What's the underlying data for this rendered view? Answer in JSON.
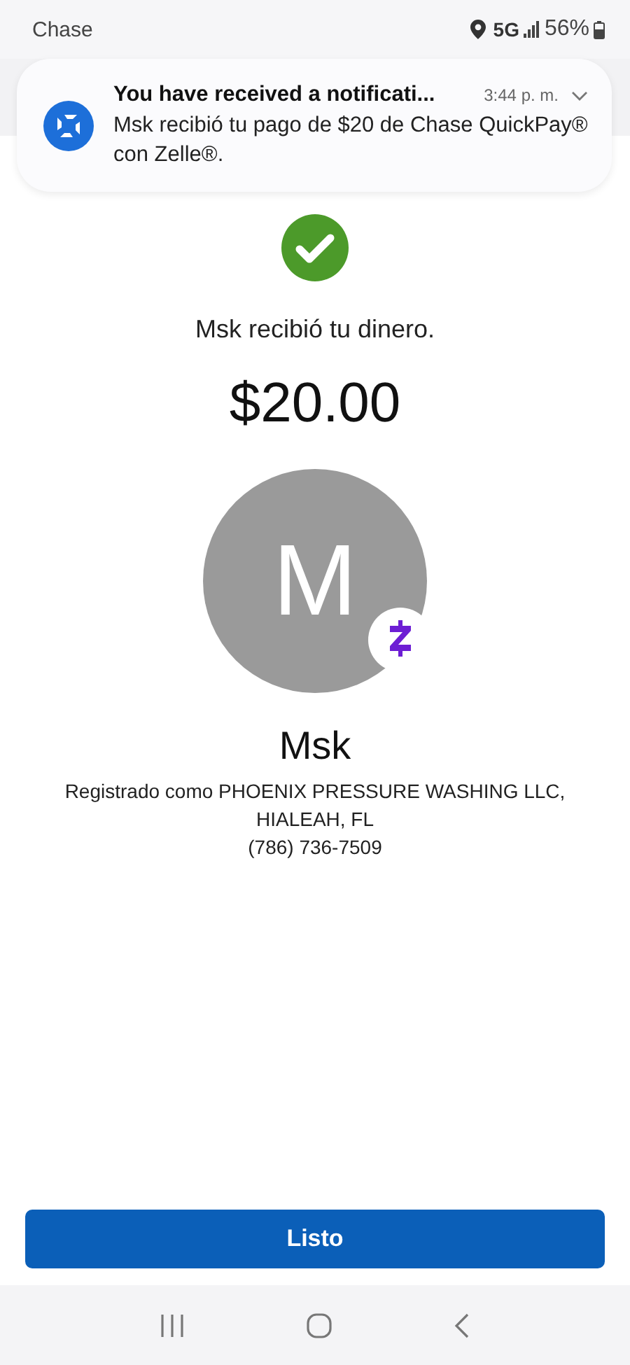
{
  "status_bar": {
    "app": "Chase",
    "network": "5G",
    "battery": "56%"
  },
  "notification": {
    "title": "You have received a notificati...",
    "time": "3:44 p. m.",
    "message": "Msk recibió tu pago de $20 de Chase QuickPay® con Zelle®."
  },
  "confirmation": {
    "message": "Msk recibió tu dinero.",
    "amount": "$20.00"
  },
  "recipient": {
    "initial": "M",
    "name": "Msk",
    "registered": "Registrado como PHOENIX PRESSURE WASHING LLC, HIALEAH, FL",
    "phone": "(786) 736-7509"
  },
  "buttons": [
    "Listo"
  ]
}
